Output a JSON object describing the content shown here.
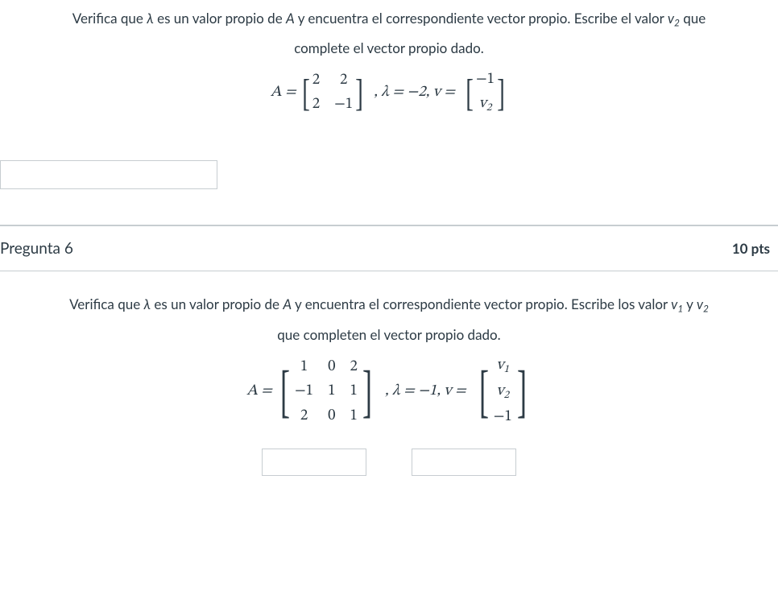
{
  "q5": {
    "prompt_a": "Verifica que ",
    "prompt_b": " es un valor propio de ",
    "prompt_c": " y encuentra el correspondiente vector propio. Escribe el valor ",
    "prompt_d": " que",
    "prompt_line2": "complete el vector propio dado.",
    "lambda_sym": "λ",
    "A_sym": "A",
    "v2_sym": "v",
    "v2_sub": "2",
    "math": {
      "A_equals": "A =",
      "a11": "2",
      "a12": "2",
      "a21": "2",
      "a22": "−1",
      "lambda_eq": ", λ = −2, v =",
      "v1": "−1",
      "v2": "v",
      "v2sub": "2"
    }
  },
  "q6": {
    "header_title": "Pregunta 6",
    "header_pts": "10 pts",
    "prompt_a": "Verifica que ",
    "prompt_b": " es un valor propio de ",
    "prompt_c": " y encuentra el correspondiente vector propio. Escribe los valor ",
    "and": " y ",
    "prompt_line2": "que completen el vector propio dado.",
    "lambda_sym": "λ",
    "A_sym": "A",
    "v1_sym": "v",
    "v1_sub": "1",
    "v2_sym": "v",
    "v2_sub": "2",
    "math": {
      "A_equals": "A =",
      "a11": "1",
      "a12": "0",
      "a13": "2",
      "a21": "−1",
      "a22": "1",
      "a23": "1",
      "a31": "2",
      "a32": "0",
      "a33": "1",
      "lambda_eq": ", λ = −1, v =",
      "vc1": "v",
      "vc1sub": "1",
      "vc2": "v",
      "vc2sub": "2",
      "vc3": "−1"
    }
  }
}
